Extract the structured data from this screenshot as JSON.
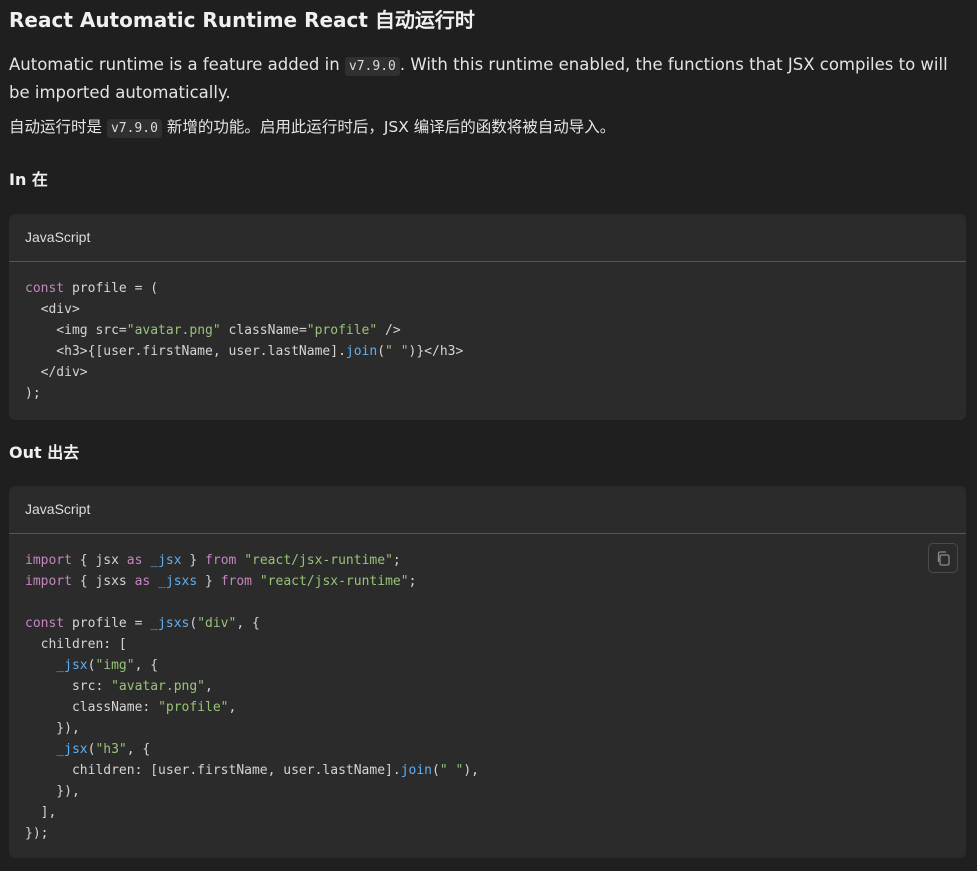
{
  "heading": "React Automatic Runtime  React 自动运行时",
  "intro_en": {
    "before": "Automatic runtime is a feature added in ",
    "code": "v7.9.0",
    "after": ". With this runtime enabled, the functions that JSX compiles to will be imported automatically."
  },
  "intro_zh": {
    "before": "自动运行时是 ",
    "code": "v7.9.0",
    "after": " 新增的功能。启用此运行时后，JSX 编译后的函数将被自动导入。"
  },
  "section_in": "In  在",
  "section_out": "Out  出去",
  "block_in": {
    "language": "JavaScript",
    "lines": [
      "const profile = (",
      "  <div>",
      "    <img src=\"avatar.png\" className=\"profile\" />",
      "    <h3>{[user.firstName, user.lastName].join(\" \")}</h3>",
      "  </div>",
      ");"
    ]
  },
  "block_out": {
    "language": "JavaScript",
    "copy_icon": "copy-icon",
    "lines": [
      "import { jsx as _jsx } from \"react/jsx-runtime\";",
      "import { jsxs as _jsxs } from \"react/jsx-runtime\";",
      "",
      "const profile = _jsxs(\"div\", {",
      "  children: [",
      "    _jsx(\"img\", {",
      "      src: \"avatar.png\",",
      "      className: \"profile\",",
      "    }),",
      "    _jsx(\"h3\", {",
      "      children: [user.firstName, user.lastName].join(\" \"),",
      "    }),",
      "  ],",
      "});"
    ]
  },
  "colors": {
    "background": "#1f1f1f",
    "code_background": "#2b2b2b",
    "keyword": "#c586c0",
    "string": "#98c379",
    "function": "#61afef"
  }
}
